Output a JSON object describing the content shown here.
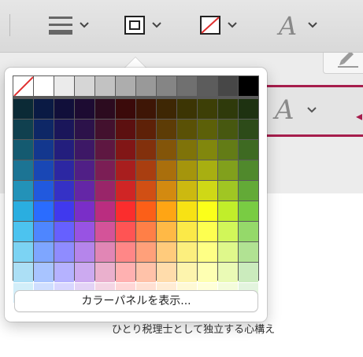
{
  "toolbar": {
    "items": [
      {
        "name": "line-style-button"
      },
      {
        "name": "border-button"
      },
      {
        "name": "fill-color-button"
      },
      {
        "name": "text-style-button",
        "glyph": "A"
      }
    ]
  },
  "style_strip": {
    "glyph": "A"
  },
  "palette": {
    "gray_row": [
      "none",
      "#ffffff",
      "#ebebeb",
      "#d6d6d6",
      "#c2c2c2",
      "#adadad",
      "#999999",
      "#858585",
      "#707070",
      "#5c5c5c",
      "#474747",
      "#000000"
    ],
    "rows": [
      [
        "#0b2a36",
        "#0a1a44",
        "#110f3a",
        "#1d0b32",
        "#2c0b1f",
        "#3b0a0a",
        "#3e1606",
        "#3e2704",
        "#3c3504",
        "#3d3f07",
        "#2f3a0b",
        "#1e3211"
      ],
      [
        "#10404f",
        "#0e2766",
        "#1a165a",
        "#2c124a",
        "#43112e",
        "#5c1010",
        "#5e2108",
        "#5d3c06",
        "#5a5106",
        "#5c6009",
        "#475810",
        "#2d4b19"
      ],
      [
        "#145a70",
        "#13378e",
        "#231e7d",
        "#3d1866",
        "#5e1741",
        "#811616",
        "#82300c",
        "#835509",
        "#7f7309",
        "#81870d",
        "#637c16",
        "#3e6a22"
      ],
      [
        "#1c7494",
        "#1947b5",
        "#2c27a2",
        "#501f86",
        "#7b1e55",
        "#a81e1e",
        "#a93e10",
        "#aa6f0c",
        "#a5950c",
        "#a8af11",
        "#81a01c",
        "#50892c"
      ],
      [
        "#2392b8",
        "#2159de",
        "#3531c6",
        "#6426a6",
        "#992569",
        "#d02525",
        "#d14f14",
        "#d38a10",
        "#ccb910",
        "#cfd816",
        "#a0c623",
        "#63aa37"
      ],
      [
        "#2aaee0",
        "#2a6cff",
        "#4039ee",
        "#7a2ec8",
        "#ba2d80",
        "#fb2d2d",
        "#fc5f18",
        "#ffa514",
        "#f7e214",
        "#fbff1a",
        "#c1ee2a",
        "#79cc43"
      ],
      [
        "#4cc3ef",
        "#4e86ff",
        "#6660ff",
        "#9853e3",
        "#d45399",
        "#ff5454",
        "#ff7f47",
        "#ffb946",
        "#fbe948",
        "#fdff50",
        "#d1f659",
        "#95d96a"
      ],
      [
        "#7cd3f3",
        "#7ea6ff",
        "#8f8cff",
        "#b585eb",
        "#e186b5",
        "#ff8787",
        "#ffa07a",
        "#ffcb7c",
        "#fcef7e",
        "#feff85",
        "#dff88b",
        "#b1e293"
      ],
      [
        "#acdff5",
        "#a8c4ff",
        "#b5b2ff",
        "#ccaaf0",
        "#eab0cd",
        "#ffb1b1",
        "#ffc2a9",
        "#ffdcab",
        "#fdf4ad",
        "#feffb2",
        "#eafab5",
        "#cbebbd"
      ],
      [
        "#d2eef9",
        "#cfdeff",
        "#d8d6ff",
        "#e3d3f6",
        "#f4d5e4",
        "#ffd6d6",
        "#ffe0d3",
        "#ffecd4",
        "#fef9d5",
        "#ffffd8",
        "#f4fcdb",
        "#e3f4de"
      ]
    ]
  },
  "panel_button_label": "カラーパネルを表示...",
  "caption": "ひとり税理士として独立する心構え"
}
